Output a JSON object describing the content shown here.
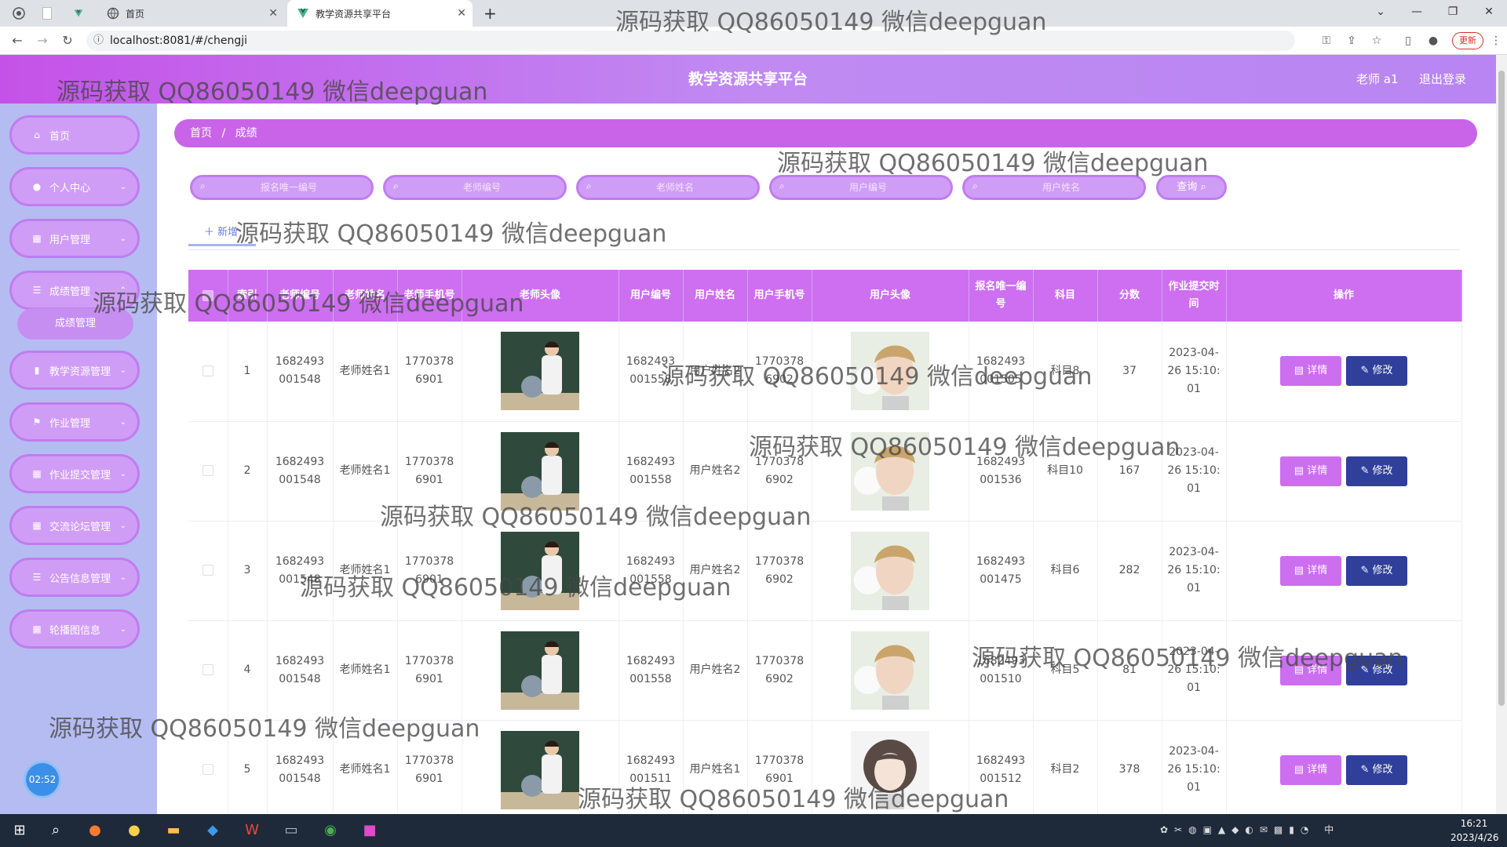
{
  "browser": {
    "tabs": [
      {
        "label": ""
      },
      {
        "label": "首页"
      },
      {
        "label": "教学资源共享平台"
      }
    ],
    "url": "localhost:8081/#/chengji",
    "update_label": "更新"
  },
  "header": {
    "title": "教学资源共享平台",
    "user": "老师 a1",
    "logout": "退出登录"
  },
  "sidebar": {
    "items": [
      {
        "label": "首页",
        "icon": "home-icon"
      },
      {
        "label": "个人中心",
        "icon": "user-icon"
      },
      {
        "label": "用户管理",
        "icon": "grid-icon"
      },
      {
        "label": "成绩管理",
        "icon": "list-icon"
      },
      {
        "label": "教学资源管理",
        "icon": "chart-icon"
      },
      {
        "label": "作业管理",
        "icon": "flag-icon"
      },
      {
        "label": "作业提交管理",
        "icon": "grid-icon"
      },
      {
        "label": "交流论坛管理",
        "icon": "grid-icon"
      },
      {
        "label": "公告信息管理",
        "icon": "list-icon"
      },
      {
        "label": "轮播图信息",
        "icon": "grid-icon"
      }
    ],
    "submenu_active": "成绩管理",
    "clock": "02:52"
  },
  "breadcrumb": {
    "home": "首页",
    "separator": "/",
    "current": "成绩"
  },
  "search": {
    "placeholders": [
      "报名唯一编号",
      "老师编号",
      "老师姓名",
      "用户编号",
      "用户姓名"
    ],
    "query_label": "查询"
  },
  "add_label": "新增",
  "table": {
    "headers": [
      "",
      "索引",
      "老师编号",
      "老师姓名",
      "老师手机号",
      "老师头像",
      "用户编号",
      "用户姓名",
      "用户手机号",
      "用户头像",
      "报名唯一编号",
      "科目",
      "分数",
      "作业提交时间",
      "操作"
    ],
    "rows": [
      {
        "index": "1",
        "teacher_no": "1682493001548",
        "teacher_name": "老师姓名1",
        "teacher_phone": "17703786901",
        "user_no": "1682493001558",
        "user_name": "用户姓名2",
        "user_phone": "17703786902",
        "signup_no": "1682493001505",
        "subject": "科目8",
        "score": "37",
        "time": "2023-04-26 15:10:01",
        "avatar": "young-man"
      },
      {
        "index": "2",
        "teacher_no": "1682493001548",
        "teacher_name": "老师姓名1",
        "teacher_phone": "17703786901",
        "user_no": "1682493001558",
        "user_name": "用户姓名2",
        "user_phone": "17703786902",
        "signup_no": "1682493001536",
        "subject": "科目10",
        "score": "167",
        "time": "2023-04-26 15:10:01",
        "avatar": "young-man"
      },
      {
        "index": "3",
        "teacher_no": "1682493001548",
        "teacher_name": "老师姓名1",
        "teacher_phone": "17703786901",
        "user_no": "1682493001558",
        "user_name": "用户姓名2",
        "user_phone": "17703786902",
        "signup_no": "1682493001475",
        "subject": "科目6",
        "score": "282",
        "time": "2023-04-26 15:10:01",
        "avatar": "young-man"
      },
      {
        "index": "4",
        "teacher_no": "1682493001548",
        "teacher_name": "老师姓名1",
        "teacher_phone": "17703786901",
        "user_no": "1682493001558",
        "user_name": "用户姓名2",
        "user_phone": "17703786902",
        "signup_no": "1682493001510",
        "subject": "科目5",
        "score": "81",
        "time": "2023-04-26 15:10:01",
        "avatar": "young-man"
      },
      {
        "index": "5",
        "teacher_no": "1682493001548",
        "teacher_name": "老师姓名1",
        "teacher_phone": "17703786901",
        "user_no": "1682493001511",
        "user_name": "用户姓名1",
        "user_phone": "17703786901",
        "signup_no": "1682493001512",
        "subject": "科目2",
        "score": "378",
        "time": "2023-04-26 15:10:01",
        "avatar": "girl-illustration"
      }
    ],
    "detail_label": "详情",
    "edit_label": "修改"
  },
  "watermark": "源码获取 QQ86050149 微信deepguan",
  "taskbar": {
    "time": "16:21",
    "date": "2023/4/26",
    "tray_ime": "中"
  },
  "colors": {
    "accent": "#c964e9",
    "sidebar_bg": "#b5bcf2",
    "edit_button": "#2f3f9a",
    "header_gradient": "#c08af2"
  }
}
